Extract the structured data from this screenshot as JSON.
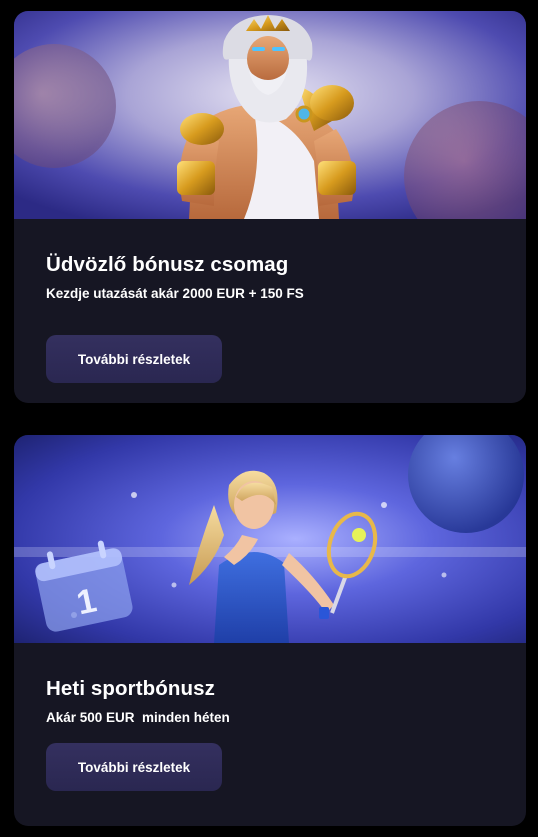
{
  "promotions": [
    {
      "title": "Üdvözlő bónusz csomag",
      "subtitle": "Kezdje utazását akár 2000 EUR + 150 FS",
      "button_label": "További részletek",
      "banner": {
        "subject": "zeus-character",
        "colors": {
          "bg_left": "#3b3aa0",
          "bg_center": "#c9c6e6",
          "bg_right": "#2a2a86"
        }
      }
    },
    {
      "title": "Heti sportbónusz",
      "subtitle": "Akár 500 EUR  minden héten",
      "button_label": "További részletek",
      "banner": {
        "subject": "tennis-player-character",
        "calendar_number": "1",
        "colors": {
          "bg_left": "#2d33a6",
          "bg_center": "#6c73e8",
          "bg_right": "#1f2477"
        }
      }
    }
  ],
  "theme": {
    "page_bg": "#000000",
    "card_bg": "#161623",
    "button_bg": "#2f2b5a",
    "text": "#ffffff"
  }
}
